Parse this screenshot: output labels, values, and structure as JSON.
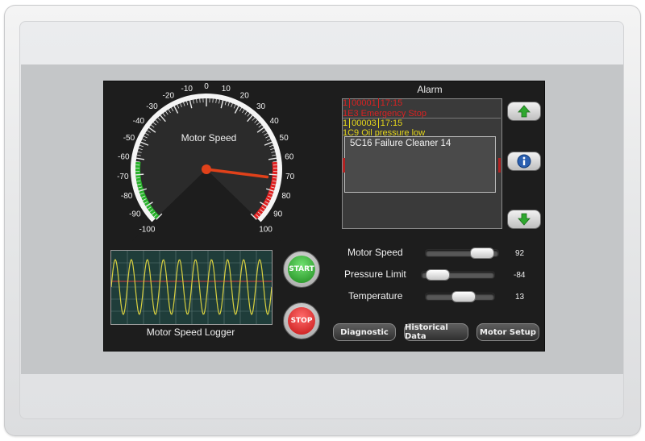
{
  "gauge": {
    "title": "Motor Speed",
    "ticks": [
      "-100",
      "-90",
      "-80",
      "-70",
      "-60",
      "-50",
      "-40",
      "-30",
      "-20",
      "-10",
      "0",
      "10",
      "20",
      "30",
      "40",
      "50",
      "60",
      "70",
      "80",
      "90",
      "100"
    ],
    "min": -100,
    "max": 100,
    "value": 72,
    "colors": {
      "green": "#27b22a",
      "red": "#e01f1f",
      "needle": "#e0411a"
    }
  },
  "alarm": {
    "title": "Alarm",
    "rows": [
      {
        "count": "1",
        "id": "00001",
        "time": "17:15",
        "color": "#d82222"
      },
      {
        "text": "1E3 Emergency Stop",
        "color": "#d82222"
      },
      {
        "count": "1",
        "id": "00003",
        "time": "17:15",
        "color": "#e6d81a"
      },
      {
        "text": "1C9 Oil pressure low",
        "color": "#e6d81a"
      }
    ],
    "popup_text": "5C16 Failure Cleaner 14"
  },
  "side_buttons": {
    "up": "arrow-up-icon",
    "info": "info-icon",
    "down": "arrow-down-icon"
  },
  "logger": {
    "label": "Motor Speed Logger"
  },
  "controls": {
    "start": "START",
    "stop": "STOP"
  },
  "sliders": [
    {
      "label": "Motor Speed",
      "value": "92",
      "level": 0.88
    },
    {
      "label": "Pressure Limit",
      "value": "-84",
      "level": 0.08
    },
    {
      "label": "Temperature",
      "value": "13",
      "level": 0.56
    }
  ],
  "buttons": {
    "diagnostic": "Diagnostic",
    "historical": "Historical Data",
    "motor_setup": "Motor Setup"
  }
}
